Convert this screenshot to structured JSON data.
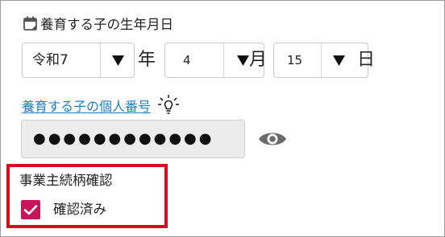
{
  "dependent_dob": {
    "label": "養育する子の生年月日",
    "era_year": "令和7",
    "year_unit": "年",
    "month": "4",
    "month_unit": "月",
    "day": "15",
    "day_unit": "日"
  },
  "personal_number": {
    "link_label": "養育する子の個人番号",
    "masked_value": "●●●●●●●●●●●●"
  },
  "employer_confirmation": {
    "title": "事業主続柄確認",
    "checkbox_label": "確認済み",
    "checked": true
  },
  "icons": {
    "calendar": "calendar-icon",
    "hint": "lightbulb-icon",
    "reveal": "eye-icon",
    "dropdown": "triangle-down-icon"
  },
  "colors": {
    "link": "#1e7ec0",
    "checkbox": "#c8145a",
    "highlight_box": "#d40c1c",
    "input_bg": "#ececec"
  }
}
